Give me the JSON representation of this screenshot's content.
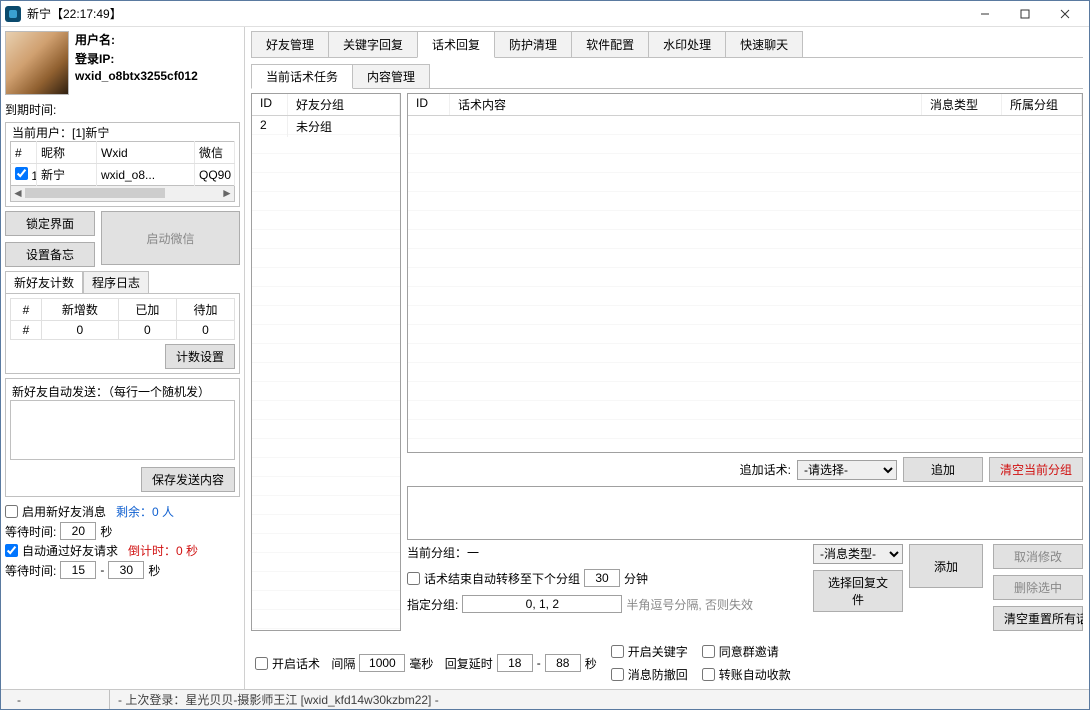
{
  "window": {
    "title": "新宁【22:17:49】"
  },
  "profile": {
    "username_label": "用户名:",
    "ip_label": "登录IP:",
    "wxid": "wxid_o8btx3255cf012",
    "expire_label": "到期时间:"
  },
  "current_user_label": "当前用户：[1]新宁",
  "user_table": {
    "headers": [
      "#",
      "昵称",
      "Wxid",
      "微信"
    ],
    "row": {
      "idx": "1",
      "nick": "新宁",
      "wxid": "wxid_o8...",
      "wx": "QQ90"
    }
  },
  "left_buttons": {
    "lock": "锁定界面",
    "memo": "设置备忘",
    "start": "启动微信"
  },
  "left_tabs": {
    "a": "新好友计数",
    "b": "程序日志"
  },
  "stats": {
    "headers": [
      "#",
      "新增数",
      "已加",
      "待加"
    ],
    "row": [
      "#",
      "0",
      "0",
      "0"
    ],
    "btn": "计数设置"
  },
  "autosend": {
    "legend": "新好友自动发送：（每行一个随机发）",
    "save": "保存发送内容"
  },
  "newfriend": {
    "enable": "启用新好友消息",
    "remain": "剩余：0 人",
    "wait": "等待时间:",
    "wait_val": "20",
    "sec": "秒",
    "auto_accept": "自动通过好友请求",
    "countdown": "倒计时：0 秒",
    "wait2a": "15",
    "wait2b": "30"
  },
  "main_tabs": [
    "好友管理",
    "关键字回复",
    "话术回复",
    "防护清理",
    "软件配置",
    "水印处理",
    "快速聊天"
  ],
  "sub_tabs": [
    "当前话术任务",
    "内容管理"
  ],
  "left_grid": {
    "h1": "ID",
    "h2": "好友分组",
    "r1a": "2",
    "r1b": "未分组"
  },
  "right_grid": {
    "h1": "ID",
    "h2": "话术内容",
    "h3": "消息类型",
    "h4": "所属分组"
  },
  "append": {
    "label": "追加话术:",
    "select": "-请选择-",
    "btn": "追加",
    "clear": "清空当前分组"
  },
  "current_group": "当前分组：一",
  "lower_buttons": {
    "msgtype": "-消息类型-",
    "choose_file": "选择回复文件",
    "add": "添加",
    "cancel": "取消修改",
    "delete": "删除选中",
    "reset": "清空重置所有话术"
  },
  "transfer": {
    "chk": "话术结束自动转移至下个分组",
    "val": "30",
    "min": "分钟",
    "assign": "指定分组:",
    "assign_val": "0, 1, 2",
    "note": "半角逗号分隔, 否则失效"
  },
  "bottom": {
    "open_script": "开启话术",
    "interval": "间隔",
    "interval_val": "1000",
    "ms": "毫秒",
    "delay": "回复延时",
    "delay_a": "18",
    "delay_b": "88",
    "sec": "秒",
    "kw": "开启关键字",
    "group_inv": "同意群邀请",
    "anti_recall": "消息防撤回",
    "auto_collect": "转账自动收款"
  },
  "status": {
    "a": "-",
    "b": "- 上次登录：星光贝贝-摄影师王江 [wxid_kfd14w30kzbm22]  -"
  }
}
